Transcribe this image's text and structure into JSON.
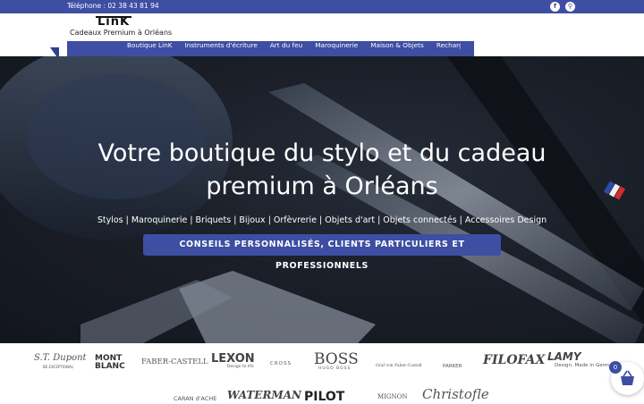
{
  "topbar": {
    "phone": "Téléphone : 02 38 43 81 94",
    "social": [
      {
        "icon": "facebook-icon",
        "glyph": "f"
      },
      {
        "icon": "location-pin-icon",
        "glyph": "⚲"
      }
    ]
  },
  "header": {
    "logo": "LinK",
    "tagline": "Cadeaux Premium à Orléans"
  },
  "nav": {
    "items": [
      "Boutique LinK",
      "Instruments d'écriture",
      "Art du feu",
      "Maroquinerie",
      "Maison & Objets",
      "Recharg"
    ]
  },
  "hero": {
    "title_line1": "Votre boutique du stylo et du cadeau",
    "title_line2": "premium à Orléans",
    "subtitle": "Stylos | Maroquinerie | Briquets | Bijoux | Orfèvrerie | Objets d'art | Objets connectés | Accessoires Design",
    "cta": "CONSEILS PERSONNALISÉS, CLIENTS PARTICULIERS ET PROFESSIONNELS"
  },
  "brands": {
    "row1": [
      {
        "name": "S.T. Dupont",
        "sub": "BE EXCEPTIONAL"
      },
      {
        "name": "MONT BLANC",
        "sub": ""
      },
      {
        "name": "FABER-CASTELL",
        "sub": ""
      },
      {
        "name": "LEXON",
        "sub": "Design to life"
      },
      {
        "name": "CROSS",
        "sub": ""
      },
      {
        "name": "BOSS",
        "sub": "HUGO BOSS"
      },
      {
        "name": "Graf von Faber-Castell",
        "sub": ""
      },
      {
        "name": "PARKER",
        "sub": ""
      },
      {
        "name": "FILOFAX",
        "sub": ""
      },
      {
        "name": "LAMY",
        "sub": "Design. Made in Germ"
      }
    ],
    "row2": [
      {
        "name": "CARAN d'ACHE"
      },
      {
        "name": "WATERMAN"
      },
      {
        "name": "PILOT"
      },
      {
        "name": "MIGNON"
      },
      {
        "name": "Christofle"
      }
    ]
  },
  "cart": {
    "count": "0",
    "icon": "shopping-basket-icon"
  },
  "colors": {
    "brand_blue": "#3d4ea3",
    "ribbon_dark": "#2f3f8f"
  }
}
